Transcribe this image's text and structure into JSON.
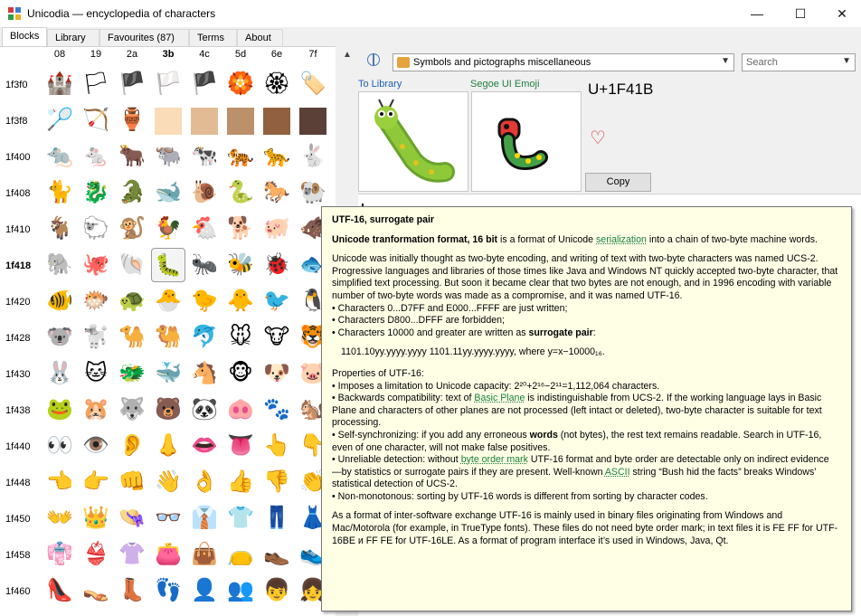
{
  "window": {
    "title": "Unicodia — encyclopedia of characters",
    "minimize": "—",
    "maximize": "☐",
    "close": "✕"
  },
  "tabs": [
    "Blocks",
    "Library",
    "Favourites (87)",
    "Terms",
    "About"
  ],
  "active_tab": "Blocks",
  "grid": {
    "columns": [
      "08",
      "19",
      "2a",
      "3b",
      "4c",
      "5d",
      "6e",
      "7f"
    ],
    "bold_column": "3b",
    "rows": [
      {
        "label": "1f3f0",
        "cells": [
          "🏰",
          "🏳",
          "🏴",
          "🏳️",
          "🏴",
          "🏵️",
          "🏵",
          "🏷️"
        ]
      },
      {
        "label": "1f3f8",
        "cells": [
          "🏸",
          "🏹",
          "🏺",
          "",
          "",
          "",
          "",
          ""
        ]
      },
      {
        "label": "1f400",
        "cells": [
          "🐀",
          "🐁",
          "🐂",
          "🐃",
          "🐄",
          "🐅",
          "🐆",
          "🐇"
        ]
      },
      {
        "label": "1f408",
        "cells": [
          "🐈",
          "🐉",
          "🐊",
          "🐋",
          "🐌",
          "🐍",
          "🐎",
          "🐏"
        ]
      },
      {
        "label": "1f410",
        "cells": [
          "🐐",
          "🐑",
          "🐒",
          "🐓",
          "🐔",
          "🐕",
          "🐖",
          "🐗"
        ]
      },
      {
        "label": "1f418",
        "cells": [
          "🐘",
          "🐙",
          "🐚",
          "🐛",
          "🐜",
          "🐝",
          "🐞",
          "🐟"
        ]
      },
      {
        "label": "1f420",
        "cells": [
          "🐠",
          "🐡",
          "🐢",
          "🐣",
          "🐤",
          "🐥",
          "🐦",
          "🐧"
        ]
      },
      {
        "label": "1f428",
        "cells": [
          "🐨",
          "🐩",
          "🐪",
          "🐫",
          "🐬",
          "🐭",
          "🐮",
          "🐯"
        ]
      },
      {
        "label": "1f430",
        "cells": [
          "🐰",
          "🐱",
          "🐲",
          "🐳",
          "🐴",
          "🐵",
          "🐶",
          "🐷"
        ]
      },
      {
        "label": "1f438",
        "cells": [
          "🐸",
          "🐹",
          "🐺",
          "🐻",
          "🐼",
          "🐽",
          "🐾",
          "🐿️"
        ]
      },
      {
        "label": "1f440",
        "cells": [
          "👀",
          "👁️",
          "👂",
          "👃",
          "👄",
          "👅",
          "👆",
          "👇"
        ]
      },
      {
        "label": "1f448",
        "cells": [
          "👈",
          "👉",
          "👊",
          "👋",
          "👌",
          "👍",
          "👎",
          "👏"
        ]
      },
      {
        "label": "1f450",
        "cells": [
          "👐",
          "👑",
          "👒",
          "👓",
          "👔",
          "👕",
          "👖",
          "👗"
        ]
      },
      {
        "label": "1f458",
        "cells": [
          "👘",
          "👙",
          "👚",
          "👛",
          "👜",
          "👝",
          "👞",
          "👟"
        ]
      },
      {
        "label": "1f460",
        "cells": [
          "👠",
          "👡",
          "👢",
          "👣",
          "👤",
          "👥",
          "👦",
          "👧"
        ]
      }
    ],
    "bold_row": "1f418",
    "selected": {
      "row": "1f418",
      "col": "3b"
    },
    "skin_tone_swatches": [
      "#fbdcb8",
      "#e2bb94",
      "#bb906a",
      "#91613f",
      "#5b4038"
    ]
  },
  "right": {
    "block_select": "Symbols and pictographs miscellaneous",
    "search_placeholder": "Search",
    "to_library": "To Library",
    "font_name": "Segoe UI Emoji",
    "codepoint": "U+1F41B",
    "glyph": "🐛",
    "heart": "♡",
    "copy_label": "Copy"
  },
  "tooltip": {
    "title": "UTF-16, surrogate pair",
    "p1_bold": "Unicode tranformation format, 16 bit",
    "p1_text1": " is a format of Unicode ",
    "p1_link": "serialization",
    "p1_text2": " into a chain of two-byte machine words.",
    "p2": "Unicode was initially thought as two-byte encoding, and writing of text with two-byte characters was named UCS-2. Progressive languages and libraries of those times like Java and Windows NT quickly accepted two-byte character, that simplified text processing. But soon it became clear that two bytes are not enough, and in 1996 encoding with variable number of two-byte words was made as a compromise, and it was named UTF-16.",
    "b1": "• Characters 0...D7FF and E000...FFFF are just written;",
    "b2": "• Characters D800...DFFF are forbidden;",
    "b3_text": "• Characters 10000 and greater are written as ",
    "b3_bold": "surrogate pair",
    "b3_end": ":",
    "formula": "1101.10yy.yyyy.yyyy 1101.11yy.yyyy.yyyy, where y=x−10000₁₆.",
    "props_title": "Properties of UTF-16:",
    "pr1": "• Imposes a limitation to Unicode capacity: 2²⁰+2¹⁶−2¹¹=1,112,064 characters.",
    "pr2_a": "• Backwards compatibility: text of ",
    "pr2_link": "Basic Plane",
    "pr2_b": " is indistinguishable from UCS-2. If the working language lays in Basic Plane and characters of other planes are not processed (left intact or deleted), two-byte character is suitable for text processing.",
    "pr3_a": "• Self-synchronizing: if you add any erroneous ",
    "pr3_bold": "words",
    "pr3_b": " (not bytes), the rest text remains readable. Search in UTF-16, even of one character, will not make false positives.",
    "pr4_a": "• Unreliable detection: without ",
    "pr4_link": "byte order mark",
    "pr4_b": " UTF-16 format and byte order are detectable only on indirect evidence —by statistics or surrogate pairs if they are present. Well-known ",
    "pr4_link2": "ASCII",
    "pr4_c": " string “Bush hid the facts” breaks Windows’ statistical detection of UCS-2.",
    "pr5": "• Non-monotonous: sorting by UTF-16 words is different from sorting by character codes.",
    "p_last": "As a format of inter-software exchange UTF-16 is mainly used in binary files originating from Windows and Mac/Motorola (for example, in TrueType fonts). These files do not need byte order mark; in text files it is FE FF for UTF-16BE и FF FE for UTF-16LE. As a format of program interface it’s used in Windows, Java, Qt."
  }
}
